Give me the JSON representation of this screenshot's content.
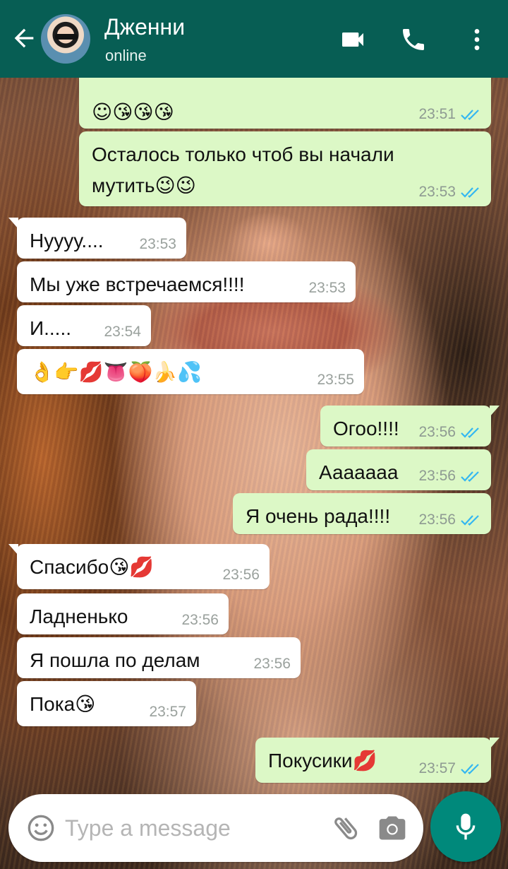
{
  "header": {
    "contact_name": "Дженни",
    "status": "online",
    "icons": [
      "back-arrow-icon",
      "video-call-icon",
      "phone-icon",
      "more-vert-icon"
    ]
  },
  "messages": [
    {
      "dir": "out",
      "text": "☺😘😘😘",
      "time": "23:51",
      "read": true
    },
    {
      "dir": "out",
      "text": "Осталось только чтоб вы начали",
      "text2": "мутить😉😉",
      "time": "23:53",
      "read": true
    },
    {
      "dir": "in",
      "text": "Нуууу....",
      "time": "23:53"
    },
    {
      "dir": "in",
      "text": "Мы уже встречаемся!!!!",
      "time": "23:53"
    },
    {
      "dir": "in",
      "text": "И.....",
      "time": "23:54"
    },
    {
      "dir": "in",
      "text": "👌👉💋👅🍑🍌💦",
      "time": "23:55"
    },
    {
      "dir": "out",
      "text": "Огоо!!!!",
      "time": "23:56",
      "read": true
    },
    {
      "dir": "out",
      "text": "Ааааааа",
      "time": "23:56",
      "read": true
    },
    {
      "dir": "out",
      "text": "Я очень рада!!!!",
      "time": "23:56",
      "read": true
    },
    {
      "dir": "in",
      "text": "Спасибо😘💋",
      "time": "23:56"
    },
    {
      "dir": "in",
      "text": "Ладненько",
      "time": "23:56"
    },
    {
      "dir": "in",
      "text": "Я пошла по делам",
      "time": "23:56"
    },
    {
      "dir": "in",
      "text": "Пока😘",
      "time": "23:57"
    },
    {
      "dir": "out",
      "text": "Покусики💋",
      "time": "23:57",
      "read": true
    }
  ],
  "composer": {
    "placeholder": "Type a message"
  },
  "colors": {
    "header": "#075e54",
    "outgoing_bubble": "#dcf8c6",
    "incoming_bubble": "#ffffff",
    "read_tick": "#34b7f1",
    "mic_button": "#00897b"
  }
}
